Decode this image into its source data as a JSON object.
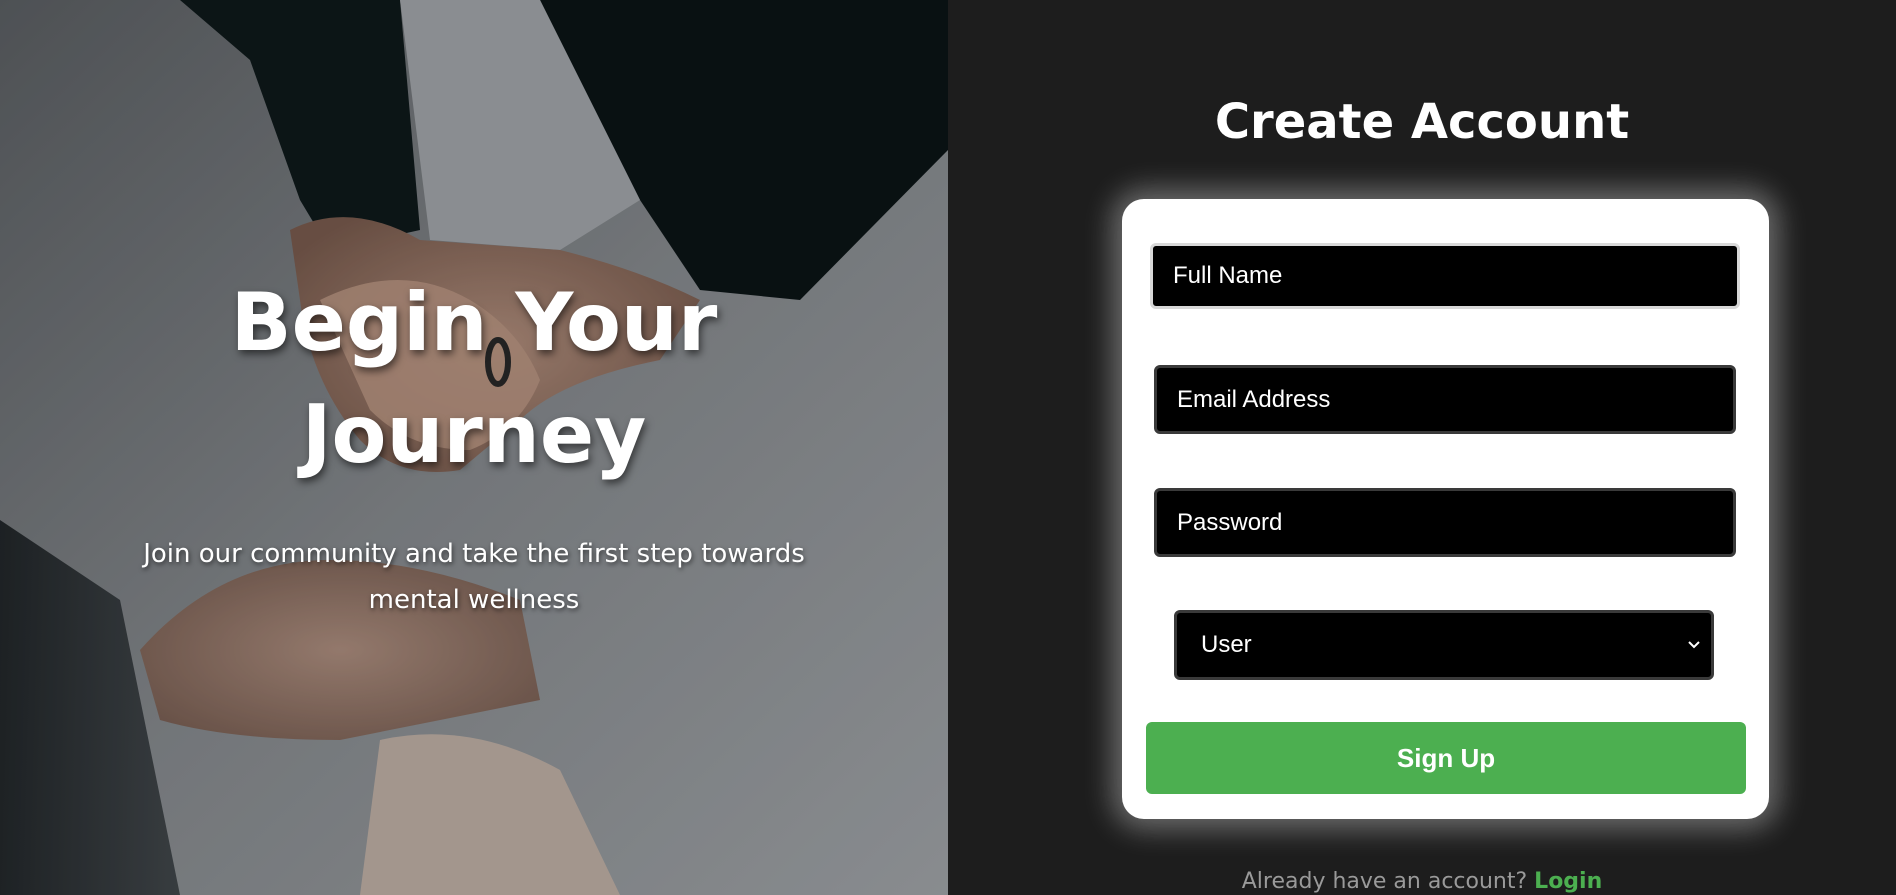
{
  "hero": {
    "title": "Begin Your Journey",
    "subtitle": "Join our community and take the first step towards mental wellness"
  },
  "form": {
    "title": "Create Account",
    "full_name_placeholder": "Full Name",
    "email_placeholder": "Email Address",
    "password_placeholder": "Password",
    "role_selected": "User",
    "role_icon": "chevron-down-icon",
    "submit_label": "Sign Up",
    "login_prompt": "Already have an account?",
    "login_link_label": "Login"
  },
  "colors": {
    "accent": "#4caf50",
    "panel_background": "#1d1d1d",
    "card_background": "#ffffff",
    "field_background": "#000000"
  }
}
